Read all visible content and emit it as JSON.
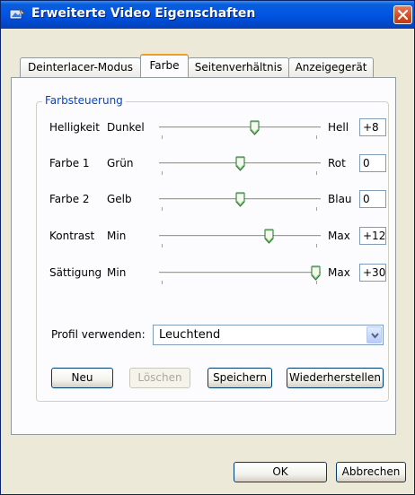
{
  "window": {
    "title": "Erweiterte Video Eigenschaften"
  },
  "tabs": [
    {
      "label": "Deinterlacer-Modus",
      "active": false
    },
    {
      "label": "Farbe",
      "active": true
    },
    {
      "label": "Seitenverhältnis",
      "active": false
    },
    {
      "label": "Anzeigegerät",
      "active": false
    }
  ],
  "group": {
    "label": "Farbsteuerung"
  },
  "sliders": [
    {
      "name": "Helligkeit",
      "min_label": "Dunkel",
      "max_label": "Hell",
      "value": "+8",
      "level": 0.6
    },
    {
      "name": "Farbe 1",
      "min_label": "Grün",
      "max_label": "Rot",
      "value": "0",
      "level": 0.5
    },
    {
      "name": "Farbe 2",
      "min_label": "Gelb",
      "max_label": "Blau",
      "value": "0",
      "level": 0.5
    },
    {
      "name": "Kontrast",
      "min_label": "Min",
      "max_label": "Max",
      "value": "+12",
      "level": 0.69
    },
    {
      "name": "Sättigung",
      "min_label": "Min",
      "max_label": "Max",
      "value": "+30",
      "level": 1.0
    }
  ],
  "profile": {
    "label": "Profil verwenden:",
    "selected": "Leuchtend"
  },
  "buttons": {
    "new": "Neu",
    "delete": "Löschen",
    "save": "Speichern",
    "restore": "Wiederherstellen"
  },
  "footer": {
    "ok": "OK",
    "cancel": "Abbrechen"
  },
  "colors": {
    "title_bar": "#0054E3",
    "group_label": "#0046D5",
    "tab_highlight": "#F0A020",
    "close_button": "#D04A25"
  },
  "icons": {
    "title": "video-properties-icon",
    "close": "close-icon",
    "dropdown": "chevron-down-icon",
    "slider_thumb": "slider-thumb-icon"
  }
}
